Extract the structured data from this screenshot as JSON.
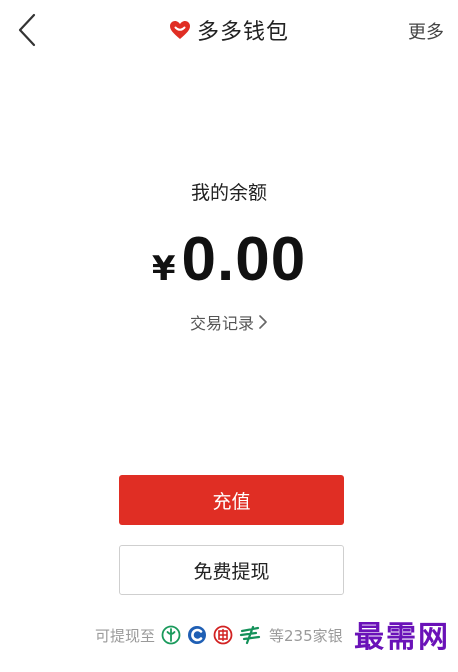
{
  "header": {
    "title": "多多钱包",
    "more_label": "更多",
    "back_icon": "chevron-left-icon",
    "brand_icon": "heart-icon",
    "brand_color": "#e02e24"
  },
  "balance": {
    "label": "我的余额",
    "currency": "¥",
    "amount": "0.00"
  },
  "transactions": {
    "label": "交易记录",
    "icon": "chevron-right-icon"
  },
  "actions": {
    "recharge_label": "充值",
    "recharge_color": "#e02e24",
    "withdraw_label": "免费提现"
  },
  "footer": {
    "prefix": "可提现至",
    "suffix": "等235家银",
    "bank_icons": [
      "abc-bank-icon",
      "ccb-bank-icon",
      "icbc-bank-icon",
      "psbc-bank-icon"
    ]
  },
  "watermark": {
    "text": "最需网"
  }
}
